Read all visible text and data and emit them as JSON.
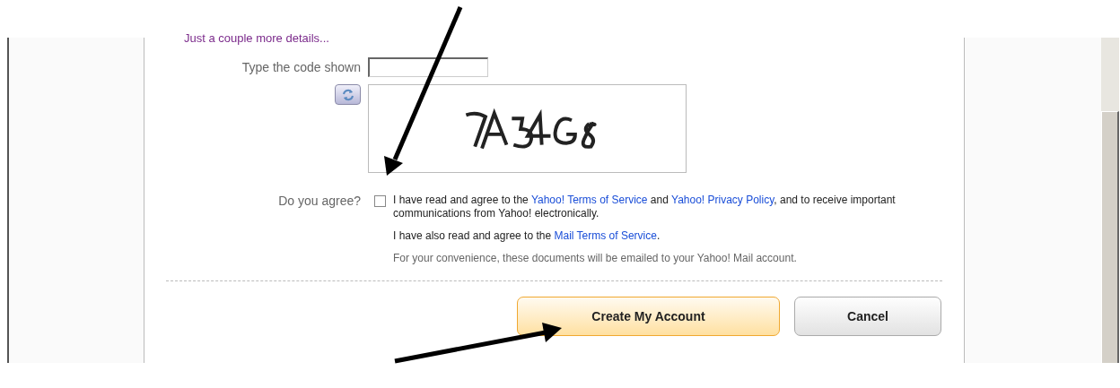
{
  "heading": "Just a couple more details...",
  "code_field": {
    "label": "Type the code shown"
  },
  "agreement": {
    "label": "Do you agree?",
    "checked": false,
    "paragraphs": [
      {
        "kind": "main",
        "parts": [
          {
            "kind": "text",
            "text": "I have read and agree to the "
          },
          {
            "kind": "link",
            "text": "Yahoo! Terms of Service"
          },
          {
            "kind": "text",
            "text": " and "
          },
          {
            "kind": "link",
            "text": "Yahoo! Privacy Policy"
          },
          {
            "kind": "text",
            "text": ", and to receive important communications from Yahoo! electronically."
          }
        ]
      },
      {
        "kind": "main",
        "parts": [
          {
            "kind": "text",
            "text": "I have also read and agree to the "
          },
          {
            "kind": "link",
            "text": "Mail Terms of Service"
          },
          {
            "kind": "text",
            "text": "."
          }
        ]
      },
      {
        "kind": "note",
        "parts": [
          {
            "kind": "text",
            "text": "For your convenience, these documents will be emailed to your Yahoo! Mail account."
          }
        ]
      }
    ]
  },
  "buttons": [
    {
      "label": "Create My Account",
      "kind": "primary"
    },
    {
      "label": "Cancel",
      "kind": "secondary"
    }
  ]
}
